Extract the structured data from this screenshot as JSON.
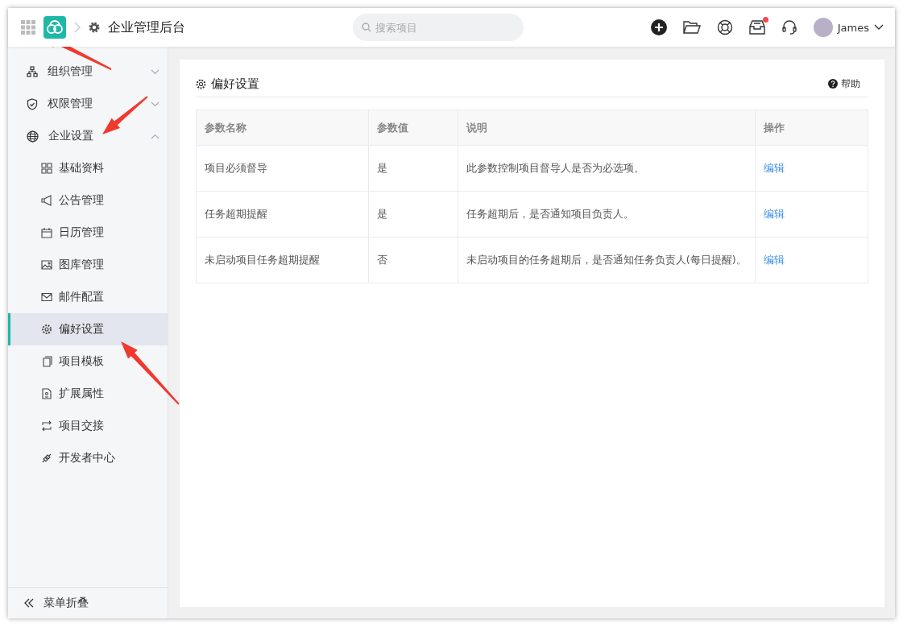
{
  "header": {
    "title": "企业管理后台",
    "search": {
      "placeholder": "搜索项目"
    },
    "inbox_unread": true,
    "user": {
      "name": "James"
    }
  },
  "sidebar": {
    "items": [
      {
        "label": "组织管理",
        "expanded": false,
        "selected": false
      },
      {
        "label": "权限管理",
        "expanded": false,
        "selected": false
      },
      {
        "label": "企业设置",
        "expanded": true,
        "selected": false,
        "children": [
          {
            "label": "基础资料",
            "selected": false
          },
          {
            "label": "公告管理",
            "selected": false
          },
          {
            "label": "日历管理",
            "selected": false
          },
          {
            "label": "图库管理",
            "selected": false
          },
          {
            "label": "邮件配置",
            "selected": false
          },
          {
            "label": "偏好设置",
            "selected": true
          },
          {
            "label": "项目模板",
            "selected": false
          },
          {
            "label": "扩展属性",
            "selected": false
          },
          {
            "label": "项目交接",
            "selected": false
          },
          {
            "label": "开发者中心",
            "selected": false
          }
        ]
      }
    ],
    "collapse_label": "菜单折叠"
  },
  "panel": {
    "title": "偏好设置",
    "help": "帮助",
    "table": {
      "columns": [
        "参数名称",
        "参数值",
        "说明",
        "操作"
      ],
      "rows": [
        {
          "name": "项目必须督导",
          "value": "是",
          "description": "此参数控制项目督导人是否为必选项。",
          "action": "编辑"
        },
        {
          "name": "任务超期提醒",
          "value": "是",
          "description": "任务超期后，是否通知项目负责人。",
          "action": "编辑"
        },
        {
          "name": "未启动项目任务超期提醒",
          "value": "否",
          "description": "未启动项目的任务超期后，是否通知任务负责人(每日提醒)。",
          "action": "编辑"
        }
      ]
    }
  }
}
